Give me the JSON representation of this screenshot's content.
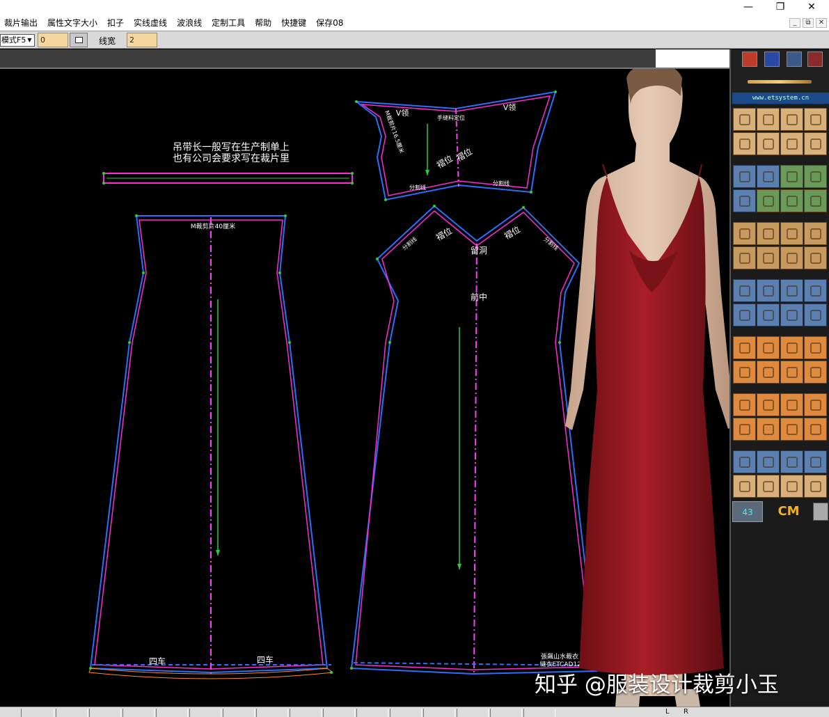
{
  "menu": {
    "items": [
      "裁片输出",
      "属性文字大小",
      "扣子",
      "实线虚线",
      "波浪线",
      "定制工具",
      "帮助",
      "快捷键",
      "保存08"
    ]
  },
  "window_controls": {
    "minimize": "—",
    "maximize": "❐",
    "close": "✕"
  },
  "mdi_controls": {
    "minimize": "_",
    "restore": "⧉",
    "close": "✕"
  },
  "toolbar": {
    "mode_value": "模式F5",
    "field1_value": "0",
    "line_width_label": "线宽",
    "line_width_value": "2"
  },
  "canvas": {
    "note_line1": "吊带长一般写在生产制单上",
    "note_line2": "也有公司会要求写在裁片里",
    "back_top_label": "M裁剪片40厘米",
    "hem_label_1": "四车",
    "hem_label_2": "四车",
    "top_piece_label_left": "V领",
    "top_piece_label_right": "V领",
    "top_piece_fold": "手缝料定位",
    "top_piece_vertical_label": "M裁剪片16.5厘米",
    "top_piece_pleat": "褶位",
    "top_piece_pleat2": "褶位",
    "top_piece_cut_left": "分割线",
    "top_piece_cut_right": "分割线",
    "front_pleat_left": "褶位",
    "front_pleat_right": "褶位",
    "front_cut_left": "分割线",
    "front_cut_right": "分割线",
    "front_hole": "留洞",
    "front_center": "前中",
    "signature_line1": "張飆山水裁衣",
    "signature_line2": "縫衣ETCAD123"
  },
  "palette": {
    "url": "www.etsystem.cn",
    "number_box": "43",
    "unit": "CM"
  },
  "statusbar": {
    "left_label": "L",
    "right_label": "R"
  },
  "watermark": {
    "text": "知乎 @服装设计裁剪小玉"
  },
  "colors": {
    "outline_blue": "#2a6fff",
    "outline_magenta": "#ff2bd6",
    "grainline_green": "#2ecc40",
    "center_line": "#ff3cff",
    "dress": "#9e1b22"
  }
}
